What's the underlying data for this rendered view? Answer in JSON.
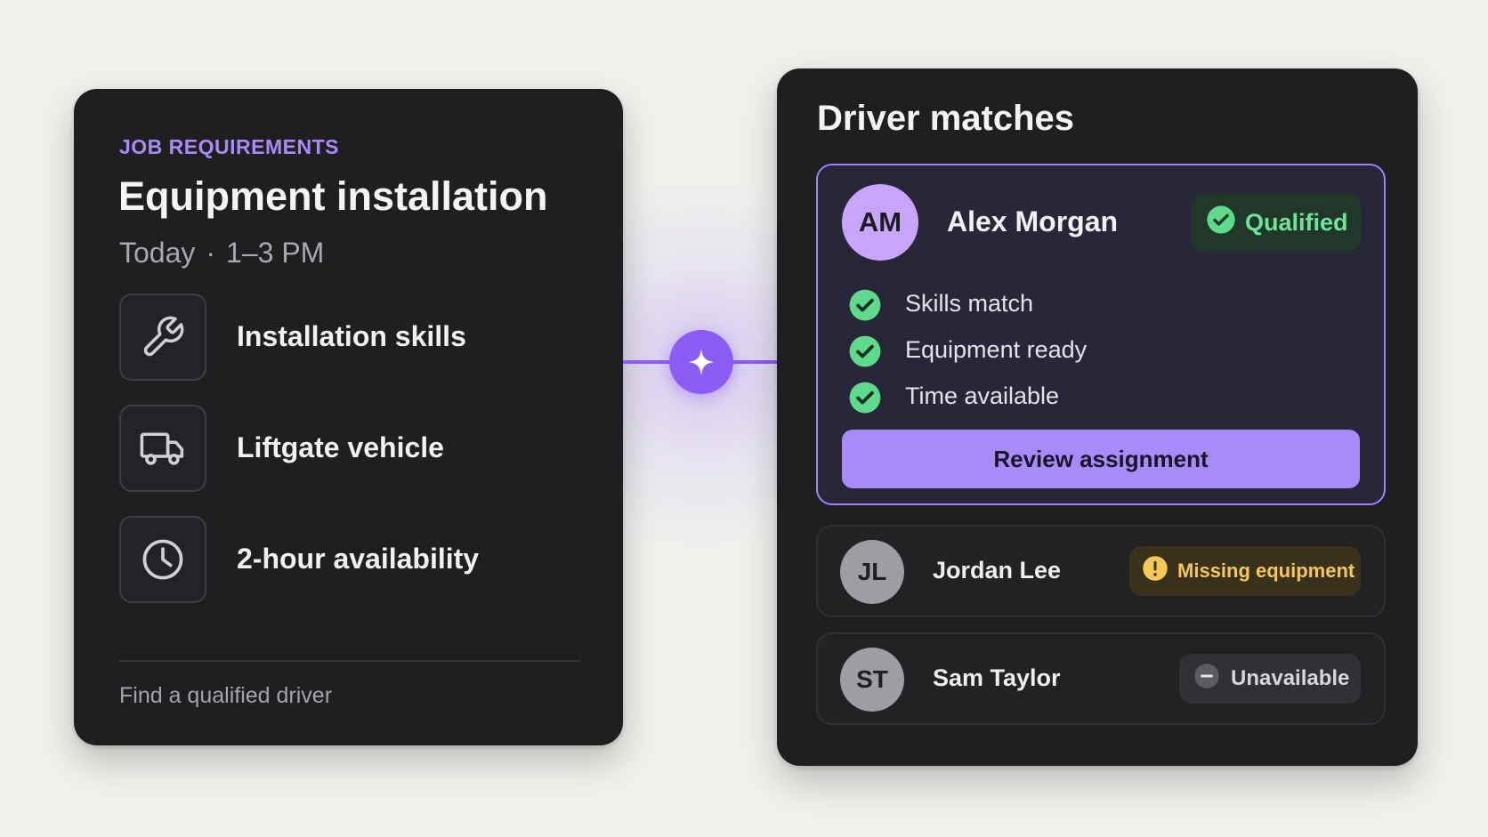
{
  "job": {
    "eyebrow": "JOB REQUIREMENTS",
    "title": "Equipment installation",
    "day": "Today",
    "separator": "·",
    "time": "1–3 PM",
    "requirements": [
      {
        "icon": "wrench-icon",
        "label": "Installation skills"
      },
      {
        "icon": "truck-icon",
        "label": "Liftgate vehicle"
      },
      {
        "icon": "clock-icon",
        "label": "2-hour availability"
      }
    ],
    "footer": "Find a qualified driver"
  },
  "connector": {
    "icon": "sparkle-icon",
    "color": "#8b5cf6"
  },
  "matches": {
    "title": "Driver matches",
    "top_match": {
      "initials": "AM",
      "name": "Alex Morgan",
      "status": "Qualified",
      "status_color": "#6fe39a",
      "checks": [
        {
          "label": "Skills match"
        },
        {
          "label": "Equipment ready"
        },
        {
          "label": "Time available"
        }
      ],
      "action": "Review assignment"
    },
    "others": [
      {
        "initials": "JL",
        "name": "Jordan Lee",
        "status": "Missing equipment",
        "status_color": "#f6c85a"
      },
      {
        "initials": "ST",
        "name": "Sam Taylor",
        "status": "Unavailable",
        "status_color": "#d6d6db"
      }
    ]
  }
}
